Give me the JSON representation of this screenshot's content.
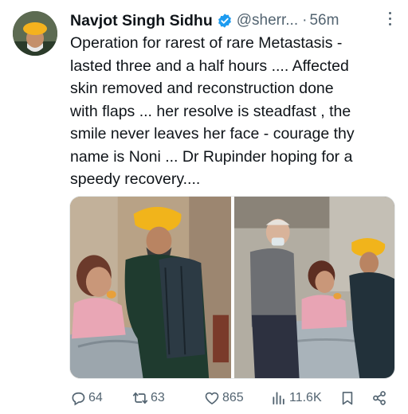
{
  "tweet": {
    "display_name": "Navjot Singh Sidhu",
    "handle": "@sherr...",
    "separator": "·",
    "time": "56m",
    "text_lines": [
      "Operation for rarest of rare Metastasis -",
      "lasted three and a half hours .... Affected",
      "skin removed and reconstruction done",
      "with flaps ... her resolve is steadfast , the",
      "smile never leaves her face - courage thy",
      "name is Noni ... Dr Rupinder hoping for a",
      "speedy recovery...."
    ]
  },
  "actions": {
    "replies": "64",
    "retweets": "63",
    "likes": "865",
    "views": "11.6K"
  },
  "icons": {
    "verified": "verified-badge-icon",
    "more": "more-options-icon",
    "reply": "reply-icon",
    "retweet": "retweet-icon",
    "like": "heart-icon",
    "views": "views-chart-icon",
    "bookmark": "bookmark-icon",
    "share": "share-icon"
  },
  "colors": {
    "verified": "#1d9bf0",
    "secondary_text": "#536471",
    "text": "#0f1419"
  }
}
